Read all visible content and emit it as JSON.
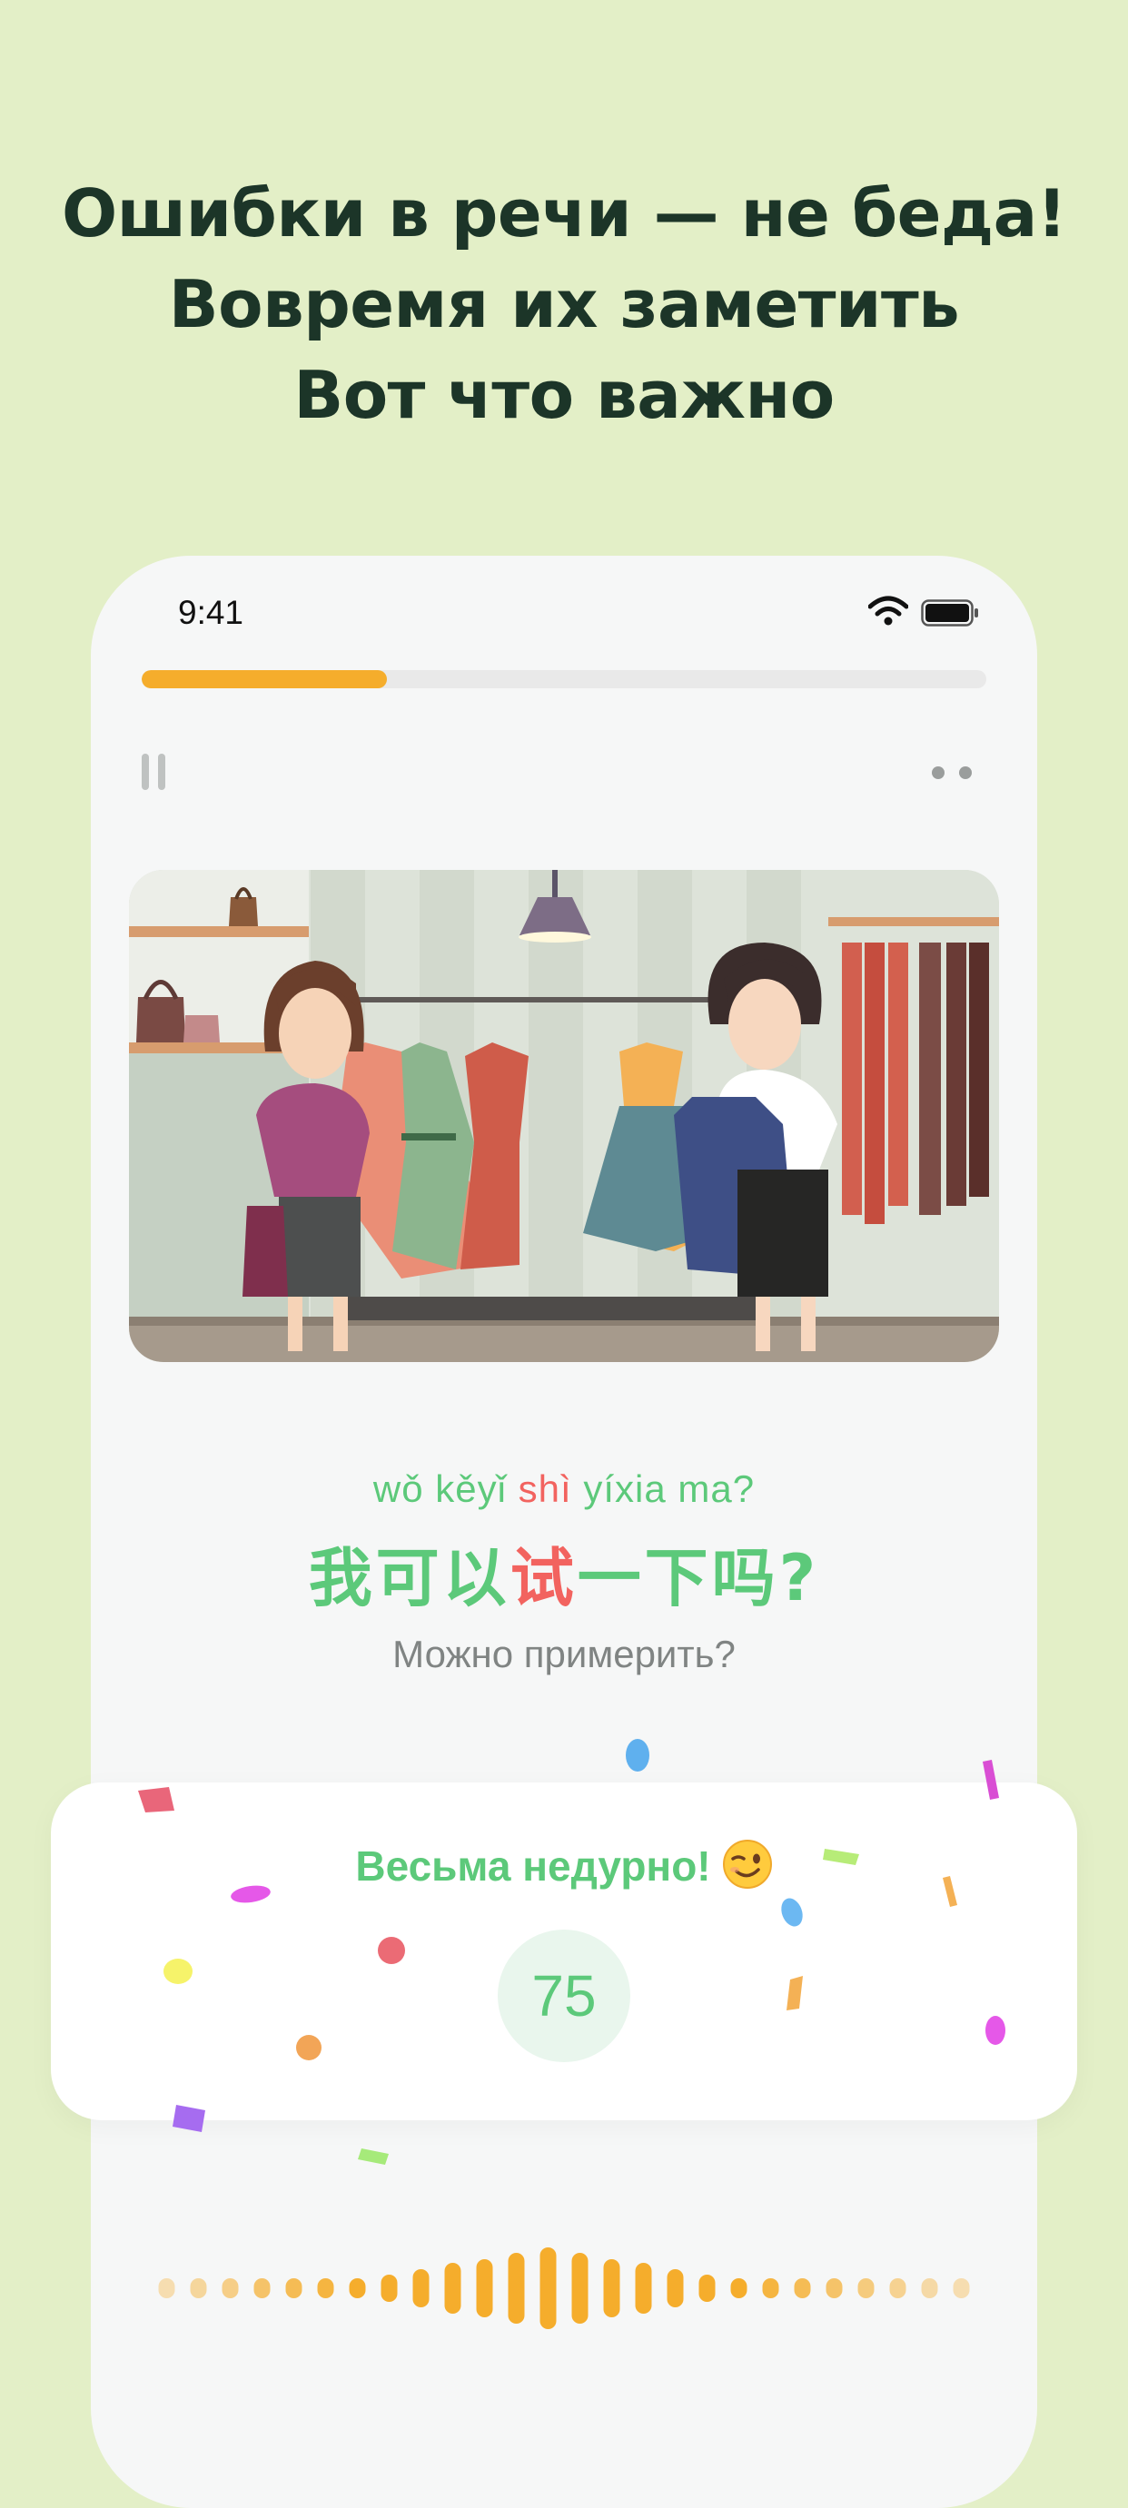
{
  "headline": {
    "line1": "Ошибки в речи — не беда!",
    "line2": "Вовремя их заметить",
    "line3": "Вот что важно"
  },
  "status_bar": {
    "time": "9:41",
    "wifi_icon": "wifi-icon",
    "battery_icon": "battery-icon"
  },
  "lesson": {
    "progress": 0.29,
    "pause_icon": "pause-icon",
    "more_icon": "more-icon",
    "scene": "clothing-store-illustration",
    "pinyin": {
      "before": "wǒ kěyǐ",
      "highlight": "shì",
      "after": "yíxia ma?"
    },
    "hanzi": {
      "before": "我可以",
      "highlight": "试",
      "after": "一下吗?"
    },
    "translation": "Можно примерить?"
  },
  "result": {
    "message": "Весьма недурно!",
    "emoji_icon": "winking-face-icon",
    "score": "75"
  },
  "colors": {
    "background": "#e3efc7",
    "headline": "#1c3528",
    "accent_green": "#5cc97a",
    "highlight_red": "#f2635f",
    "progress_orange": "#f5ad2c"
  }
}
